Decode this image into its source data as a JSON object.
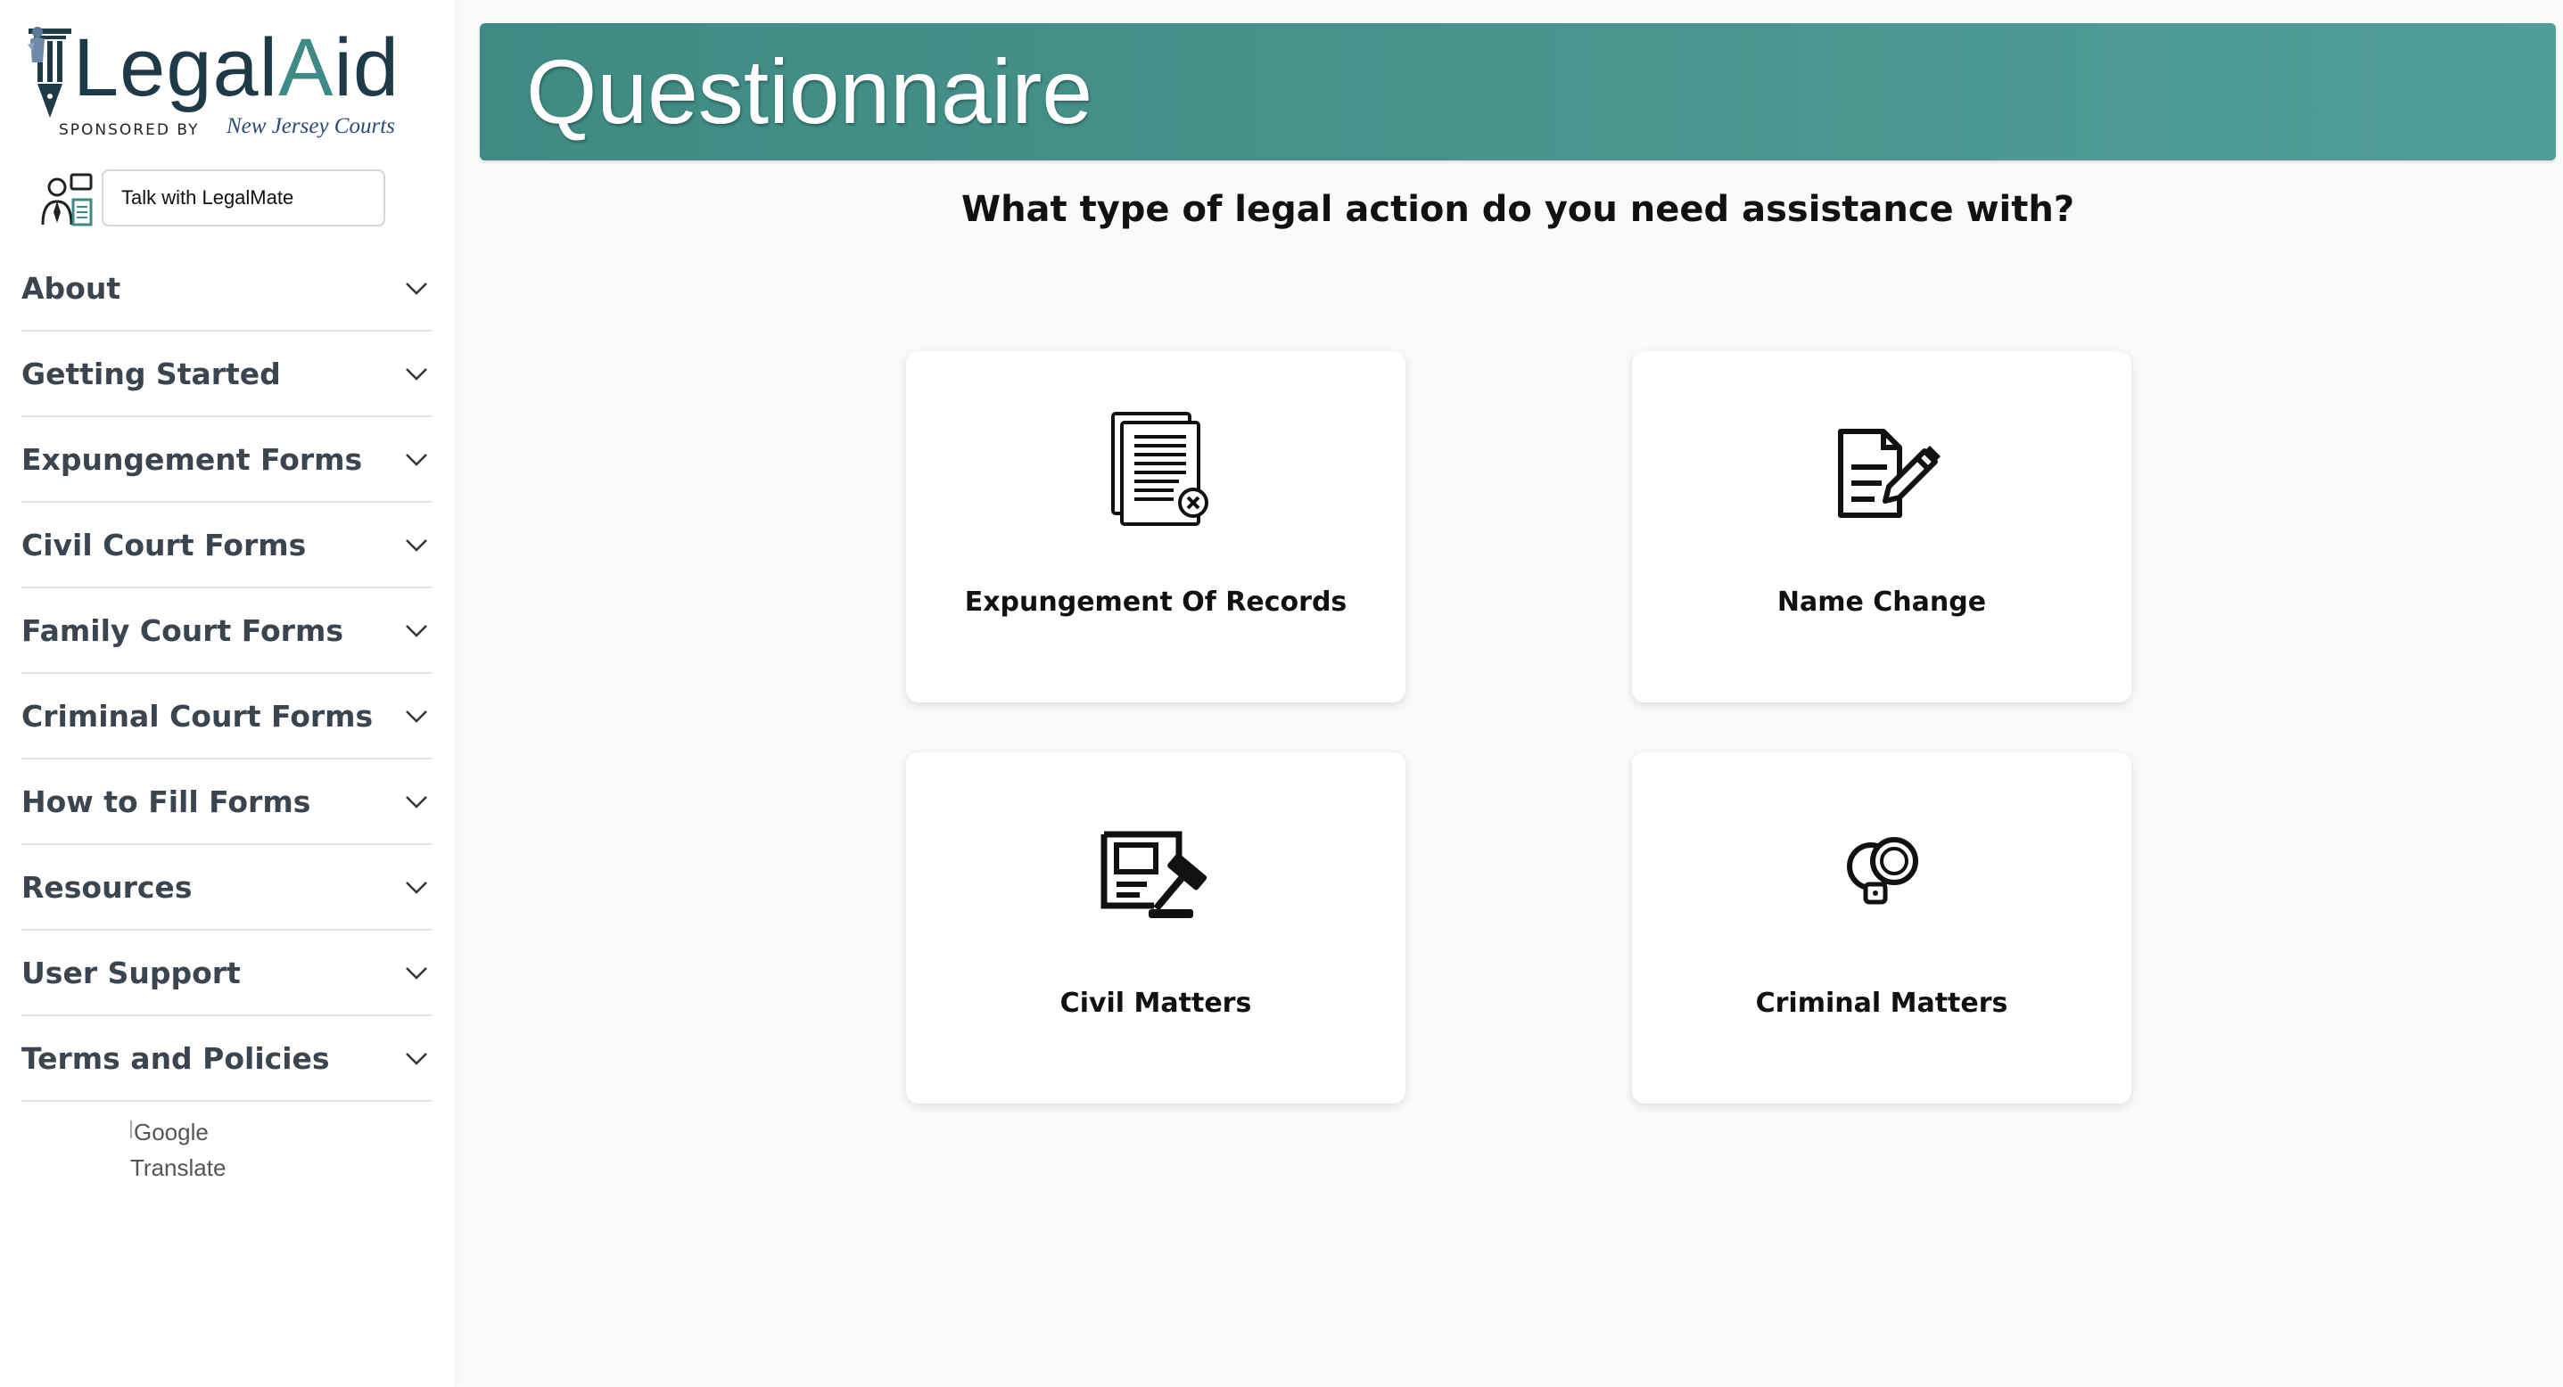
{
  "brand": {
    "logo_text_part1": "Legal",
    "logo_text_part2": "A",
    "logo_text_part3": "id",
    "sponsored_by": "SPONSORED BY",
    "sponsor_name": "New Jersey Courts",
    "accent_color": "#3e8a86",
    "dark_color": "#1e3a47"
  },
  "chat": {
    "button_label": "Talk with LegalMate",
    "icon": "assistant-icon"
  },
  "sidebar": {
    "items": [
      {
        "label": "About"
      },
      {
        "label": "Getting Started"
      },
      {
        "label": "Expungement Forms"
      },
      {
        "label": "Civil Court Forms"
      },
      {
        "label": "Family Court Forms"
      },
      {
        "label": "Criminal Court Forms"
      },
      {
        "label": "How to Fill Forms"
      },
      {
        "label": "Resources"
      },
      {
        "label": "User Support"
      },
      {
        "label": "Terms and Policies"
      }
    ],
    "expand_icon": "chevron-down-icon"
  },
  "translate": {
    "alt_line1": "Google",
    "alt_line2": "Translate"
  },
  "header": {
    "title": "Questionnaire",
    "banner_color": "#468f89"
  },
  "main": {
    "question": "What type of legal action do you need assistance with?",
    "options": [
      {
        "label": "Expungement Of Records",
        "icon": "document-remove-icon"
      },
      {
        "label": "Name Change",
        "icon": "document-edit-icon"
      },
      {
        "label": "Civil Matters",
        "icon": "gavel-icon"
      },
      {
        "label": "Criminal Matters",
        "icon": "handcuffs-icon"
      }
    ]
  }
}
